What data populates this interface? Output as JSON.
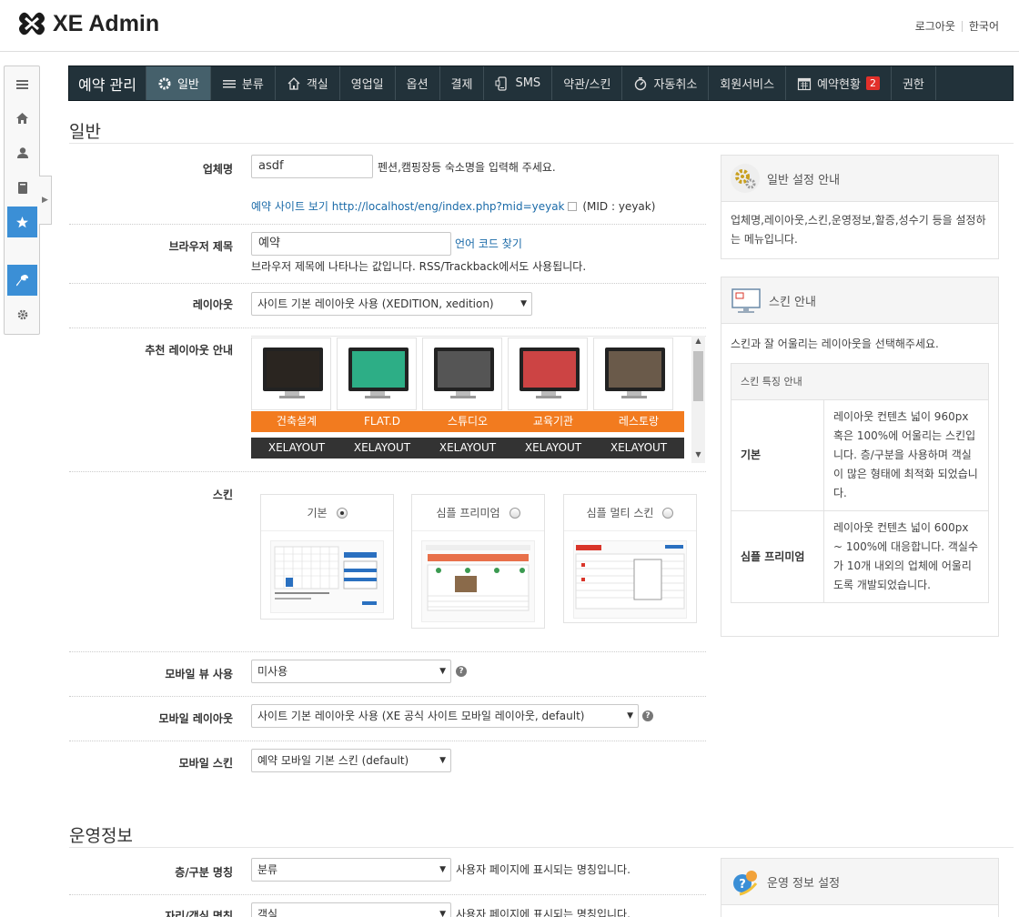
{
  "header": {
    "app_title": "XE Admin",
    "logout": "로그아웃",
    "language": "한국어"
  },
  "leftbar": {
    "items": [
      "menu-icon",
      "home-icon",
      "user-icon",
      "book-icon",
      "star-icon",
      "wrench-icon",
      "gear-icon"
    ]
  },
  "topnav": {
    "brand": "예약 관리",
    "items": [
      {
        "label": "일반",
        "icon": "gear-icon",
        "active": true
      },
      {
        "label": "분류",
        "icon": "list-icon"
      },
      {
        "label": "객실",
        "icon": "house-icon"
      },
      {
        "label": "영업일"
      },
      {
        "label": "옵션"
      },
      {
        "label": "결제"
      },
      {
        "label": "SMS",
        "icon": "phone-icon"
      },
      {
        "label": "약관/스킨"
      },
      {
        "label": "자동취소",
        "icon": "timer-icon"
      },
      {
        "label": "회원서비스"
      },
      {
        "label": "예약현황",
        "icon": "calendar-icon",
        "badge": "2"
      },
      {
        "label": "권한"
      }
    ]
  },
  "general": {
    "section_title": "일반",
    "company_name": {
      "label": "업체명",
      "value": "asdf",
      "help": "펜션,캠핑장등 숙소명을 입력해 주세요.",
      "site_link_label": "예약 사이트 보기",
      "site_url": "http://localhost/eng/index.php?mid=yeyak",
      "mid_text": "(MID : yeyak)"
    },
    "browser_title": {
      "label": "브라우저 제목",
      "value": "예약",
      "lang_link": "언어 코드 찾기",
      "help": "브라우저 제목에 나타나는 값입니다. RSS/Trackback에서도 사용됩니다."
    },
    "layout": {
      "label": "레이아웃",
      "selected": "사이트 기본 레이아웃 사용 (XEDITION, xedition)"
    },
    "recommended_layouts": {
      "label": "추천 레이아웃 안내",
      "items": [
        {
          "name": "건축설계",
          "vendor": "XELAYOUT",
          "screen": "#2a2520"
        },
        {
          "name": "FLAT.D",
          "vendor": "XELAYOUT",
          "screen": "#2dae86"
        },
        {
          "name": "스튜디오",
          "vendor": "XELAYOUT",
          "screen": "#555"
        },
        {
          "name": "교육기관",
          "vendor": "XELAYOUT",
          "screen": "#c44"
        },
        {
          "name": "레스토랑",
          "vendor": "XELAYOUT",
          "screen": "#6a5a4a"
        }
      ]
    },
    "skin": {
      "label": "스킨",
      "options": [
        {
          "name": "기본",
          "checked": true
        },
        {
          "name": "심플 프리미엄",
          "checked": false
        },
        {
          "name": "심플 멀티 스킨",
          "checked": false
        }
      ]
    },
    "mobile_view": {
      "label": "모바일 뷰 사용",
      "selected": "미사용"
    },
    "mobile_layout": {
      "label": "모바일 레이아웃",
      "selected": "사이트 기본 레이아웃 사용 (XE 공식 사이트 모바일 레이아웃, default)"
    },
    "mobile_skin": {
      "label": "모바일 스킨",
      "selected": "예약 모바일 기본 스킨 (default)"
    }
  },
  "panels": {
    "general_guide": {
      "title": "일반 설정 안내",
      "body": "업체명,레이아웃,스킨,운영정보,할증,성수기 등을 설정하는 메뉴입니다."
    },
    "skin_guide": {
      "title": "스킨 안내",
      "body": "스킨과 잘 어울리는 레이아웃을 선택해주세요.",
      "table_header": "스킨 특징 안내",
      "rows": [
        {
          "name": "기본",
          "desc": "레이아웃 컨텐츠 넓이 960px 혹은 100%에 어울리는 스킨입니다. 층/구분을 사용하며 객실이 많은 형태에 최적화 되었습니다."
        },
        {
          "name": "심플 프리미엄",
          "desc": "레이아웃 컨텐츠 넓이 600px ~ 100%에 대응합니다. 객실수가 10개 내외의 업체에 어울리도록 개발되었습니다."
        }
      ]
    },
    "operation_guide": {
      "title": "운영 정보 설정"
    }
  },
  "operation": {
    "section_title": "운영정보",
    "floor_name": {
      "label": "층/구분 명칭",
      "selected": "분류",
      "help": "사용자 페이지에 표시되는 명칭입니다."
    },
    "room_name": {
      "label": "자리/객실 명칭",
      "selected": "객실",
      "help": "사용자 페이지에 표시되는 명칭입니다."
    }
  },
  "colors": {
    "nav_bg": "#22323a",
    "nav_active": "#45606b",
    "accent_orange": "#f27b1f",
    "link_blue": "#1a6aa8",
    "sidebar_active": "#3b8fd6"
  }
}
